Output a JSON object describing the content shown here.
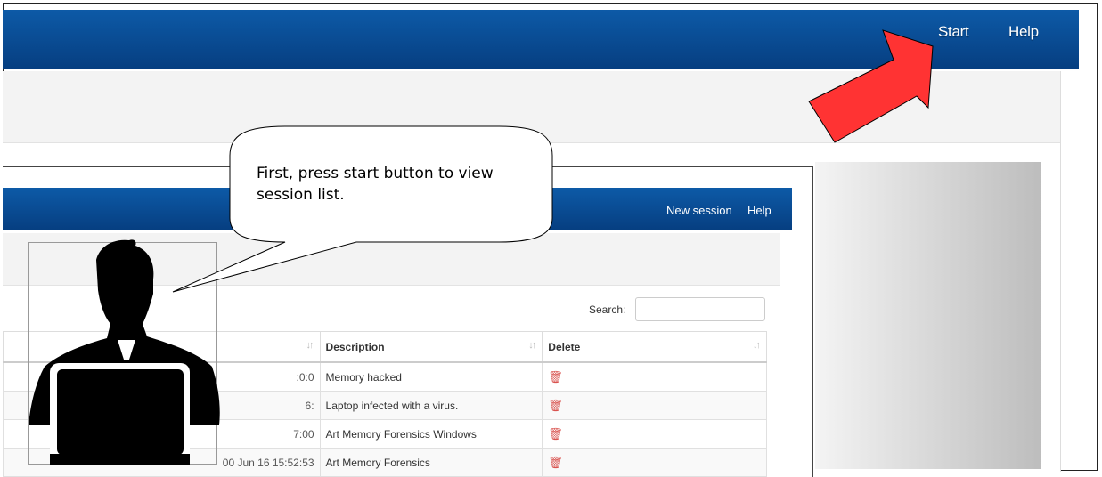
{
  "topnav": {
    "start": "Start",
    "help": "Help"
  },
  "subnav": {
    "new_session": "New session",
    "help": "Help"
  },
  "search": {
    "label": "Search:",
    "value": ""
  },
  "table": {
    "headers": [
      "",
      "Description",
      "Delete"
    ],
    "rows": [
      {
        "date": ":0:0",
        "description": "Memory hacked"
      },
      {
        "date": "6:",
        "description": "Laptop infected with a virus."
      },
      {
        "date": "7:00",
        "description": "Art Memory Forensics Windows"
      },
      {
        "date": "00 Jun 16 15:52:53",
        "description": "Art Memory Forensics"
      }
    ]
  },
  "callout": {
    "text": "First, press start button to view session list."
  },
  "icons": {
    "trash": "trash-icon",
    "sort": "sort-icon",
    "arrow": "red-arrow",
    "user": "user-laptop-icon"
  },
  "colors": {
    "navbar": "#0d5aa7",
    "arrow": "#ff3333",
    "trash": "#d9534f"
  }
}
